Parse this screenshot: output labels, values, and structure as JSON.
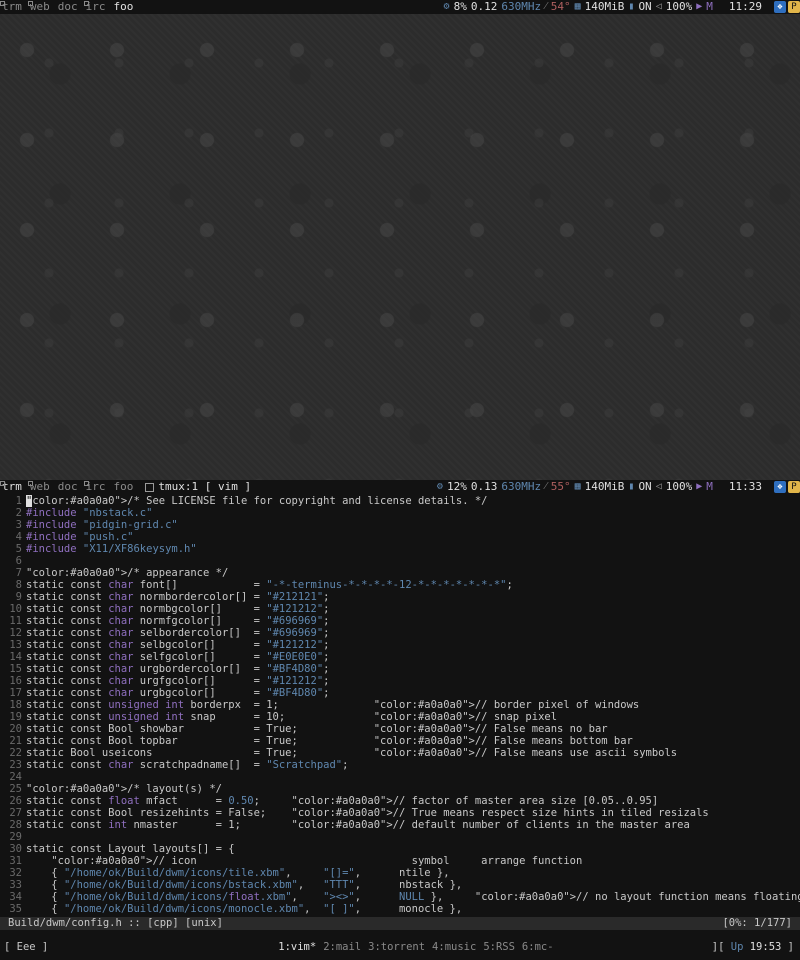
{
  "top_bar": {
    "tags": [
      "trm",
      "web",
      "doc",
      "irc",
      "foo"
    ],
    "title": "",
    "clock": "11:29",
    "status": {
      "cpu": "8%",
      "load": "0.12",
      "freq": "630MHz",
      "temp": "54°",
      "mem": "140MiB",
      "wifi": "ON",
      "vol": "100%",
      "mail": "M"
    }
  },
  "bottom_bar": {
    "tags": [
      "trm",
      "web",
      "doc",
      "irc",
      "foo"
    ],
    "title": "tmux:1 [ vim ]",
    "clock": "11:33",
    "status": {
      "cpu": "12%",
      "load": "0.13",
      "freq": "630MHz",
      "temp": "55°",
      "mem": "140MiB",
      "wifi": "ON",
      "vol": "100%",
      "mail": "M"
    }
  },
  "tray": {
    "dropbox": "❖",
    "pidgin": "P"
  },
  "code_lines": [
    {
      "n": "1",
      "t": "/* See LICENSE file for copyright and license details. */"
    },
    {
      "n": "2",
      "t": "#include \"nbstack.c\""
    },
    {
      "n": "3",
      "t": "#include \"pidgin-grid.c\""
    },
    {
      "n": "4",
      "t": "#include \"push.c\""
    },
    {
      "n": "5",
      "t": "#include \"X11/XF86keysym.h\""
    },
    {
      "n": "6",
      "t": ""
    },
    {
      "n": "7",
      "t": "/* appearance */"
    },
    {
      "n": "8",
      "t": "static const char font[]            = \"-*-terminus-*-*-*-*-12-*-*-*-*-*-*-*\";"
    },
    {
      "n": "9",
      "t": "static const char normbordercolor[] = \"#212121\";"
    },
    {
      "n": "10",
      "t": "static const char normbgcolor[]     = \"#121212\";"
    },
    {
      "n": "11",
      "t": "static const char normfgcolor[]     = \"#696969\";"
    },
    {
      "n": "12",
      "t": "static const char selbordercolor[]  = \"#696969\";"
    },
    {
      "n": "13",
      "t": "static const char selbgcolor[]      = \"#121212\";"
    },
    {
      "n": "14",
      "t": "static const char selfgcolor[]      = \"#E0E0E0\";"
    },
    {
      "n": "15",
      "t": "static const char urgbordercolor[]  = \"#BF4D80\";"
    },
    {
      "n": "16",
      "t": "static const char urgfgcolor[]      = \"#121212\";"
    },
    {
      "n": "17",
      "t": "static const char urgbgcolor[]      = \"#BF4D80\";"
    },
    {
      "n": "18",
      "t": "static const unsigned int borderpx  = 1;               // border pixel of windows"
    },
    {
      "n": "19",
      "t": "static const unsigned int snap      = 10;              // snap pixel"
    },
    {
      "n": "20",
      "t": "static const Bool showbar           = True;            // False means no bar"
    },
    {
      "n": "21",
      "t": "static const Bool topbar            = True;            // False means bottom bar"
    },
    {
      "n": "22",
      "t": "static Bool useicons                = True;            // False means use ascii symbols"
    },
    {
      "n": "23",
      "t": "static const char scratchpadname[]  = \"Scratchpad\";"
    },
    {
      "n": "24",
      "t": ""
    },
    {
      "n": "25",
      "t": "/* layout(s) */"
    },
    {
      "n": "26",
      "t": "static const float mfact      = 0.50;     // factor of master area size [0.05..0.95]"
    },
    {
      "n": "27",
      "t": "static const Bool resizehints = False;    // True means respect size hints in tiled resizals"
    },
    {
      "n": "28",
      "t": "static const int nmaster      = 1;        // default number of clients in the master area"
    },
    {
      "n": "29",
      "t": ""
    },
    {
      "n": "30",
      "t": "static const Layout layouts[] = {"
    },
    {
      "n": "31",
      "t": "    // icon                                  symbol     arrange function"
    },
    {
      "n": "32",
      "t": "    { \"/home/ok/Build/dwm/icons/tile.xbm\",     \"[]=\",      ntile },"
    },
    {
      "n": "33",
      "t": "    { \"/home/ok/Build/dwm/icons/bstack.xbm\",   \"TTT\",      nbstack },"
    },
    {
      "n": "34",
      "t": "    { \"/home/ok/Build/dwm/icons/float.xbm\",    \"><>\",      NULL },     // no layout function means floating behavior"
    },
    {
      "n": "35",
      "t": "    { \"/home/ok/Build/dwm/icons/monocle.xbm\",  \"[ ]\",      monocle },"
    }
  ],
  "vim_status": {
    "file": "Build/dwm/config.h :: [cpp] [unix]",
    "pos": "[0%: 1/177]"
  },
  "tmux": {
    "left": "[ Eee ]",
    "windows": [
      "1:vim*",
      "2:mail",
      "3:torrent",
      "4:music",
      "5:RSS",
      "6:mc-"
    ],
    "uptime_label": "Up",
    "uptime_time": "19:53",
    "left_bracket": "][",
    "right_bracket": "]"
  }
}
